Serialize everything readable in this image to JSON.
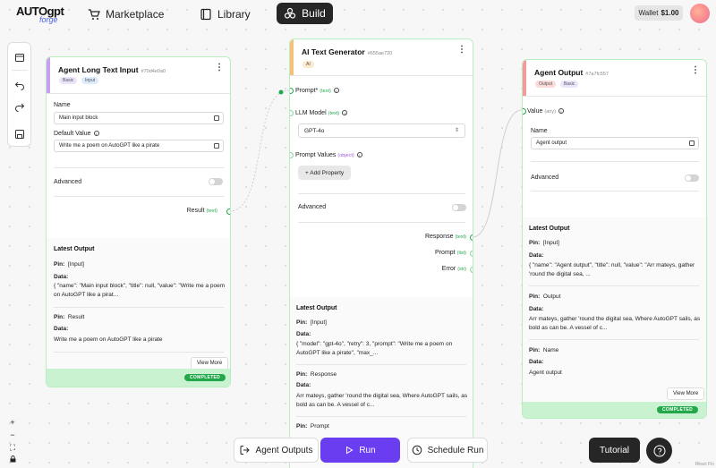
{
  "header": {
    "logo_main": "AUTOgpt",
    "logo_sub": "forge",
    "nav": [
      {
        "label": "Marketplace",
        "icon": "cart-icon"
      },
      {
        "label": "Library",
        "icon": "book-icon"
      },
      {
        "label": "Build",
        "icon": "build-icon",
        "active": true
      }
    ],
    "wallet_label": "Wallet",
    "wallet_amount": "$1.00"
  },
  "nodes": {
    "long_text_input": {
      "title": "Agent Long Text Input",
      "id": "#70d4e0a0",
      "badges": [
        "Basic",
        "Input"
      ],
      "name_label": "Name",
      "name_value": "Main input block",
      "default_label": "Default Value",
      "default_value": "Write me a poem on AutoGPT like a pirate",
      "advanced_label": "Advanced",
      "output_port_label": "Result",
      "output_port_type": "(text)",
      "latest_output_heading": "Latest Output",
      "outputs": [
        {
          "pin_label": "Pin:",
          "pin": "[Input]",
          "data_label": "Data:",
          "data": "{ \"name\": \"Main input block\", \"title\": null, \"value\": \"Write me a poem on AutoGPT like a pirat..."
        },
        {
          "pin_label": "Pin:",
          "pin": "Result",
          "data_label": "Data:",
          "data": "Write me a poem on AutoGPT like a pirate"
        }
      ],
      "view_more": "View More",
      "status": "COMPLETED"
    },
    "ai_text_generator": {
      "title": "AI Text Generator",
      "id": "#655ae720",
      "badges": [
        "AI"
      ],
      "prompt_label": "Prompt*",
      "prompt_type": "(text)",
      "llm_label": "LLM Model",
      "llm_type": "(text)",
      "llm_value": "GPT-4o",
      "prompt_values_label": "Prompt Values",
      "prompt_values_type": "(object)",
      "add_property": "+ Add Property",
      "advanced_label": "Advanced",
      "outputs_ports": [
        {
          "label": "Response",
          "type": "(text)"
        },
        {
          "label": "Prompt",
          "type": "(list)"
        },
        {
          "label": "Error",
          "type": "(str)"
        }
      ],
      "latest_output_heading": "Latest Output",
      "outputs": [
        {
          "pin_label": "Pin:",
          "pin": "[Input]",
          "data_label": "Data:",
          "data": "{ \"model\": \"gpt-4o\", \"retry\": 3, \"prompt\": \"Write me a poem on AutoGPT like a pirate\", \"max_..."
        },
        {
          "pin_label": "Pin:",
          "pin": "Response",
          "data_label": "Data:",
          "data": "Arr mateys, gather 'round the digital sea, Where AutoGPT sails, as bold as can be. A vessel of c..."
        },
        {
          "pin_label": "Pin:",
          "pin": "Prompt"
        }
      ]
    },
    "agent_output": {
      "title": "Agent Output",
      "id": "#7a7fc557",
      "badges": [
        "Output",
        "Basic"
      ],
      "value_label": "Value",
      "value_type": "(any)",
      "name_label": "Name",
      "name_value": "Agent output",
      "advanced_label": "Advanced",
      "latest_output_heading": "Latest Output",
      "outputs": [
        {
          "pin_label": "Pin:",
          "pin": "[Input]",
          "data_label": "Data:",
          "data": "{ \"name\": \"Agent output\", \"title\": null, \"value\": \"Arr mateys, gather 'round the digital sea, ..."
        },
        {
          "pin_label": "Pin:",
          "pin": "Output",
          "data_label": "Data:",
          "data": "Arr mateys, gather 'round the digital sea, Where AutoGPT sails, as bold as can be. A vessel of c..."
        },
        {
          "pin_label": "Pin:",
          "pin": "Name",
          "data_label": "Data:",
          "data": "Agent output"
        }
      ],
      "view_more": "View More",
      "status": "COMPLETED"
    }
  },
  "bottom": {
    "agent_outputs": "Agent Outputs",
    "run": "Run",
    "schedule_run": "Schedule Run",
    "tutorial": "Tutorial",
    "react_flow": "React Flo"
  },
  "colors": {
    "accent_purple": "#6a3ef0",
    "completed_green": "#22a84a",
    "input_bar": "#c9a0f0",
    "ai_bar": "#f6c07a",
    "output_bar": "#f59a9a"
  }
}
